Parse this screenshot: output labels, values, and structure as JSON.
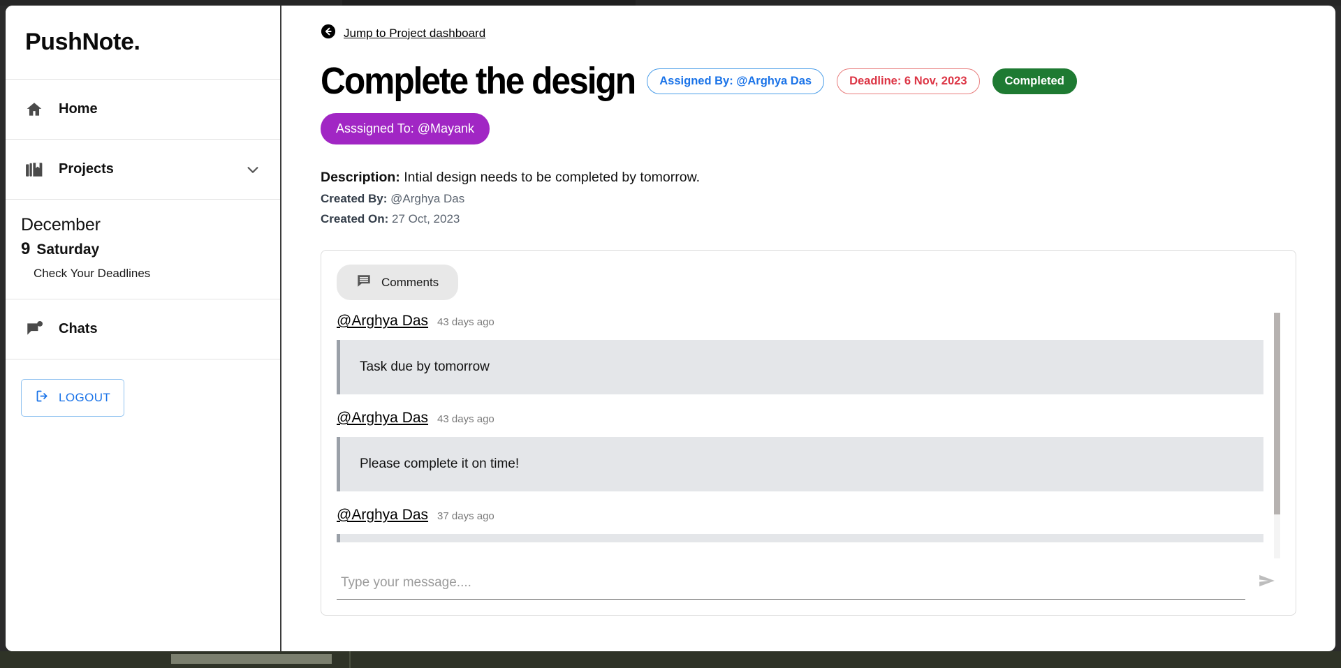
{
  "brand": {
    "name": "PushNote."
  },
  "sidebar": {
    "items": [
      {
        "label": "Home",
        "icon": "home-icon"
      },
      {
        "label": "Projects",
        "icon": "projects-icon",
        "chevron": "chevron-down-icon"
      },
      {
        "label": "Chats",
        "icon": "chat-flag-icon"
      }
    ],
    "date": {
      "month": "December",
      "day_number": "9",
      "day_name": "Saturday",
      "note": "Check Your Deadlines"
    },
    "logout": {
      "label": "LOGOUT",
      "icon": "logout-icon",
      "color": "#1a73e8"
    }
  },
  "main": {
    "back_link": {
      "label": "Jump to Project dashboard",
      "icon": "back-arrow-circle-icon"
    },
    "title": "Complete the design",
    "badges": {
      "assigned_by": {
        "label": "Assigned By: @Arghya Das",
        "color": "#1a73e8"
      },
      "deadline": {
        "label": "Deadline: 6 Nov, 2023",
        "color": "#dc3545"
      },
      "status": {
        "label": "Completed",
        "color": "#1e7a32"
      },
      "assigned_to": {
        "label": "Asssigned To: @Mayank",
        "color": "#a126c4"
      }
    },
    "description": {
      "label": "Description:",
      "text": "Intial design needs to be completed by tomorrow."
    },
    "created_by": {
      "label": "Created By:",
      "value": "@Arghya Das"
    },
    "created_on": {
      "label": "Created On:",
      "value": "27 Oct, 2023"
    }
  },
  "comments": {
    "tab_label": "Comments",
    "tab_icon": "comment-icon",
    "list": [
      {
        "author": "@Arghya Das",
        "age": "43 days ago",
        "text": "Task due by tomorrow"
      },
      {
        "author": "@Arghya Das",
        "age": "43 days ago",
        "text": "Please complete it on time!"
      },
      {
        "author": "@Arghya Das",
        "age": "37 days ago",
        "text": ""
      }
    ],
    "composer": {
      "placeholder": "Type your message....",
      "value": "",
      "send_icon": "send-icon"
    }
  }
}
